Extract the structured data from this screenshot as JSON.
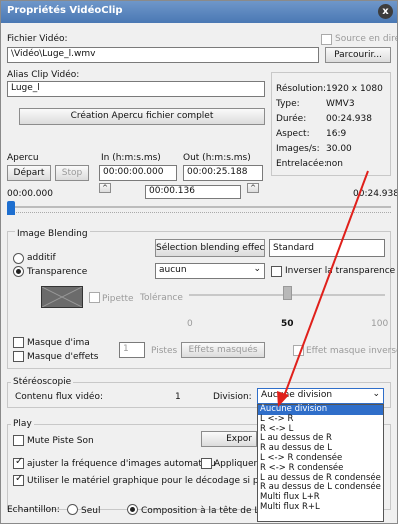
{
  "window": {
    "title": "Propriétés VidéoClip",
    "close_label": "x"
  },
  "file": {
    "label": "Fichier Vidéo:",
    "value": "\\Vidéo\\Luge_l.wmv",
    "source_label": "Source en direc",
    "browse_label": "Parcourir..."
  },
  "alias": {
    "label": "Alias Clip Vidéo:",
    "value": "Luge_l"
  },
  "preview_button": "Création Apercu fichier complet",
  "info": {
    "rows": [
      {
        "k": "Résolution:",
        "v": "1920 x 1080"
      },
      {
        "k": "Type:",
        "v": "WMV3"
      },
      {
        "k": "Durée:",
        "v": "00:24.938"
      },
      {
        "k": "Aspect:",
        "v": "16:9"
      },
      {
        "k": "Images/s:",
        "v": "30.00"
      },
      {
        "k": "Entrelacée:",
        "v": "non"
      }
    ]
  },
  "apercu": {
    "label": "Apercu",
    "start_label": "Départ",
    "stop_label": "Stop",
    "in_label": "In (h:m:s.ms)",
    "out_label": "Out (h:m:s.ms)",
    "in_value": "00:00:00.000",
    "out_value": "00:00:25.188",
    "pos_start": "00:00.000",
    "pos_mid": "00:00.136",
    "pos_end": "00:24.938",
    "scrubber_pos": 0.0
  },
  "blending": {
    "title": "Image Blending",
    "additif_label": "additif",
    "transparence_label": "Transparence",
    "select_button": "Sélection blending effect",
    "standard": "Standard",
    "dropdown_value": "aucun",
    "invert_label": "Inverser la transparence",
    "pipette_label": "Pipette",
    "tolerance_label": "Tolérance",
    "slider_min": "0",
    "slider_mid": "50",
    "slider_max": "100",
    "slider_value": 50
  },
  "mask": {
    "masque_img": "Masque d'ima",
    "masque_eff": "Masque d'effets",
    "num_value": "1",
    "pistes": "Pistes",
    "effets_button": "Effets masqués",
    "effet_inv": "Effet masque inversé"
  },
  "stereo": {
    "title": "Stéréoscopie",
    "contenu_label": "Contenu flux vidéo:",
    "contenu_value": "1",
    "division_label": "Division:",
    "division_value": "Aucune division"
  },
  "play": {
    "title": "Play",
    "mute_label": "Mute Piste Son",
    "export_label": "Expor",
    "ajuster_label": "ajuster la fréquence d'images automatiqu",
    "appliquer_label": "Appliquer le",
    "utiliser_label": "Utiliser le matériel graphique pour le décodage si possible"
  },
  "echantillon": {
    "label": "Echantillon:",
    "seul": "Seul",
    "composition": "Composition à la tête de Lec"
  },
  "division_options": [
    "Aucune division",
    "L <-> R",
    "R <-> L",
    "L au dessus de R",
    "R au dessus de L",
    "L <-> R condensée",
    "R <-> R condensée",
    "L au dessus de R condensée",
    "R au dessus de L condensée",
    "Multi flux L+R",
    "Multi flux R+L"
  ],
  "colors": {
    "title_bg": "#4a78b4",
    "selection": "#2f6ec9",
    "arrow": "#e0201b",
    "scrubber": "#1e6fd0"
  }
}
